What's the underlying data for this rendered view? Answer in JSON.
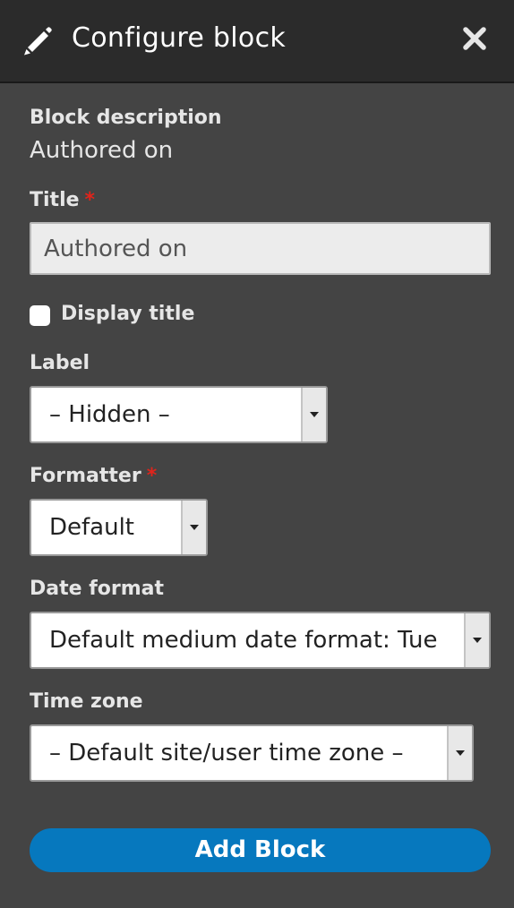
{
  "dialog": {
    "title": "Configure block",
    "icons": {
      "edit": "pencil-icon",
      "close": "close-icon"
    }
  },
  "form": {
    "block_description": {
      "label": "Block description",
      "value": "Authored on"
    },
    "title": {
      "label": "Title",
      "required_mark": "*",
      "value": "Authored on"
    },
    "display_title": {
      "label": "Display title",
      "checked": false
    },
    "label": {
      "label": "Label",
      "selected": "– Hidden –"
    },
    "formatter": {
      "label": "Formatter",
      "required_mark": "*",
      "selected": "Default"
    },
    "date_format": {
      "label": "Date format",
      "selected": "Default medium date format: Tue"
    },
    "time_zone": {
      "label": "Time zone",
      "selected": "– Default site/user time zone –"
    }
  },
  "actions": {
    "submit_label": "Add Block"
  },
  "colors": {
    "header_bg": "#2b2b2b",
    "panel_bg": "#444444",
    "primary_button": "#0678be",
    "required": "#e0241b"
  }
}
